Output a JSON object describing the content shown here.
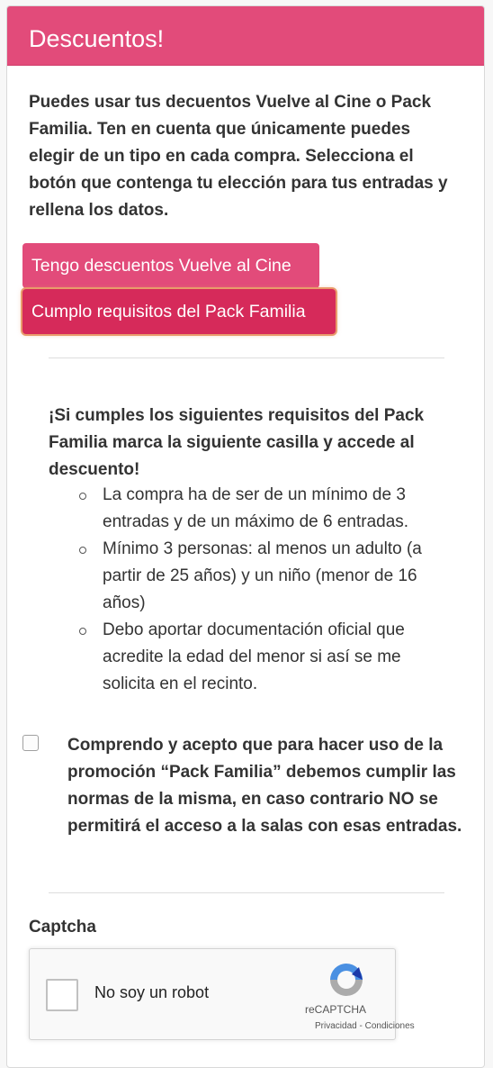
{
  "header": {
    "title": "Descuentos!"
  },
  "intro": {
    "text": "Puedes usar tus decuentos Vuelve al Cine o Pack Familia. Ten en cuenta que únicamente puedes elegir de un tipo en cada compra. Selecciona el botón que contenga tu elección para tus entradas y rellena los datos."
  },
  "buttons": {
    "vuelve_al_cine": "Tengo descuentos Vuelve al Cine",
    "pack_familia": "Cumplo requisitos del Pack Familia"
  },
  "pack_familia": {
    "title": "¡Si cumples los siguientes requisitos del Pack Familia marca la siguiente casilla y accede al descuento!",
    "requirements": [
      "La compra ha de ser de un mínimo de 3 entradas y de un máximo de 6 entradas.",
      "Mínimo 3 personas: al menos un adulto (a partir de 25 años) y un niño (menor de 16 años)",
      "Debo aportar documentación oficial que acredite la edad del menor si así se me solicita en el recinto."
    ],
    "accept_label": "Comprendo y acepto que para hacer uso de la promoción “Pack Familia” debemos cumplir las normas de la misma, en caso contrario NO se permitirá el acceso a la salas con esas entradas.",
    "accept_checked": false
  },
  "captcha": {
    "label": "Captcha",
    "checkbox_text": "No soy un robot",
    "brand": "reCAPTCHA",
    "privacy": "Privacidad",
    "separator": " - ",
    "terms": "Condiciones",
    "logo_icon": "recaptcha-logo-icon"
  },
  "colors": {
    "accent": "#e24b7a",
    "accent_active": "#d62a5a",
    "focus_ring": "#e99b6b"
  }
}
